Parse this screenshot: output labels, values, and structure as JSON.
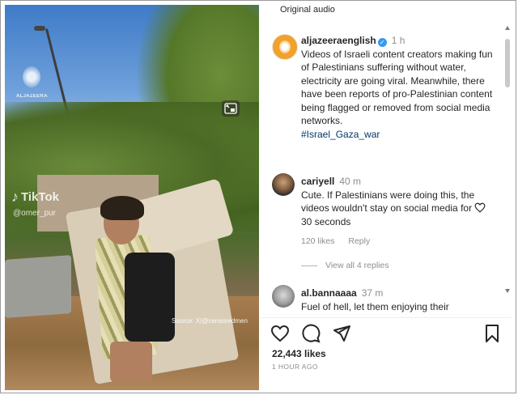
{
  "video": {
    "tiktok_brand": "TikTok",
    "tiktok_user": "@omer_pur",
    "source_text": "Source: X/@censoredmen",
    "channel_watermark": "ALJAZEERA"
  },
  "panel": {
    "audio_label": "Original audio",
    "post": {
      "username": "aljazeeraenglish",
      "time": "1 h",
      "caption": "Videos of Israeli content creators making fun of Palestinians suffering without water, electricity are going viral. Meanwhile, there have been reports of pro-Palestinian content being flagged or removed from social media networks.",
      "hashtag": "#Israel_Gaza_war"
    },
    "comments": [
      {
        "username": "cariyell",
        "time": "40 m",
        "text": "Cute. If Palestinians were doing this, the videos wouldn't stay on social media for 30 seconds",
        "likes": "120 likes",
        "reply_label": "Reply",
        "view_replies": "View all 4 replies"
      },
      {
        "username": "al.bannaaaa",
        "time": "37 m",
        "text": "Fuel of hell, let them enjoying their"
      }
    ],
    "likes_count": "22,443 likes",
    "time_ago": "1 HOUR AGO"
  },
  "icons": {
    "like": "heart-icon",
    "comment": "comment-icon",
    "share": "share-icon",
    "save": "bookmark-icon",
    "pip": "picture-in-picture-icon",
    "verified": "verified-badge-icon"
  },
  "colors": {
    "text": "#262626",
    "muted": "#8e8e8e",
    "verified": "#3897f0",
    "hashtag": "#00376b",
    "brand": "#f2a12a"
  }
}
